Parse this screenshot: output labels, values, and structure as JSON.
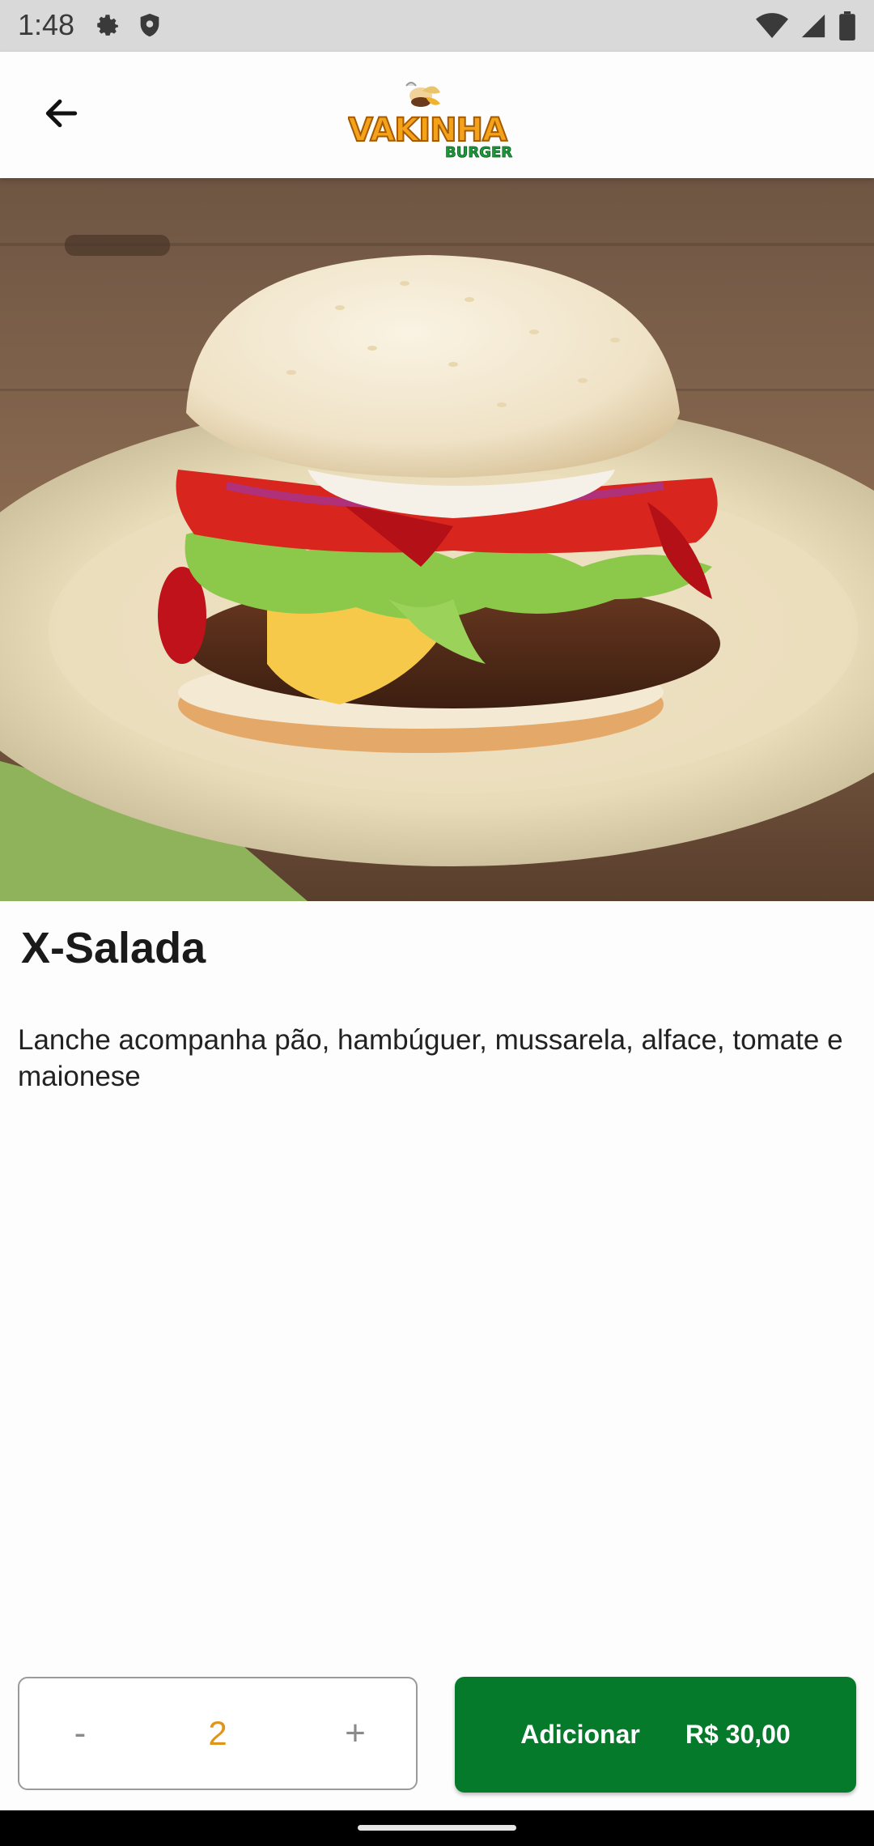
{
  "status_bar": {
    "time": "1:48",
    "icons": [
      "settings-icon",
      "shield-icon",
      "wifi-icon",
      "signal-icon",
      "battery-icon"
    ]
  },
  "app_bar": {
    "back_icon": "arrow-back-icon",
    "logo_text_main": "VAKINHA",
    "logo_text_sub": "BURGER"
  },
  "product": {
    "image": "burger-photo",
    "name": "X-Salada",
    "description": "Lanche acompanha pão, hambúguer, mussarela, alface, tomate e maionese"
  },
  "quantity": {
    "minus_label": "-",
    "value": "2",
    "plus_label": "+"
  },
  "add_button": {
    "label": "Adicionar",
    "price": "R$ 30,00"
  },
  "colors": {
    "primary_green": "#047a2a",
    "quantity_orange": "#e0951a",
    "logo_orange": "#f5a21b",
    "logo_green": "#1c9b3a"
  }
}
